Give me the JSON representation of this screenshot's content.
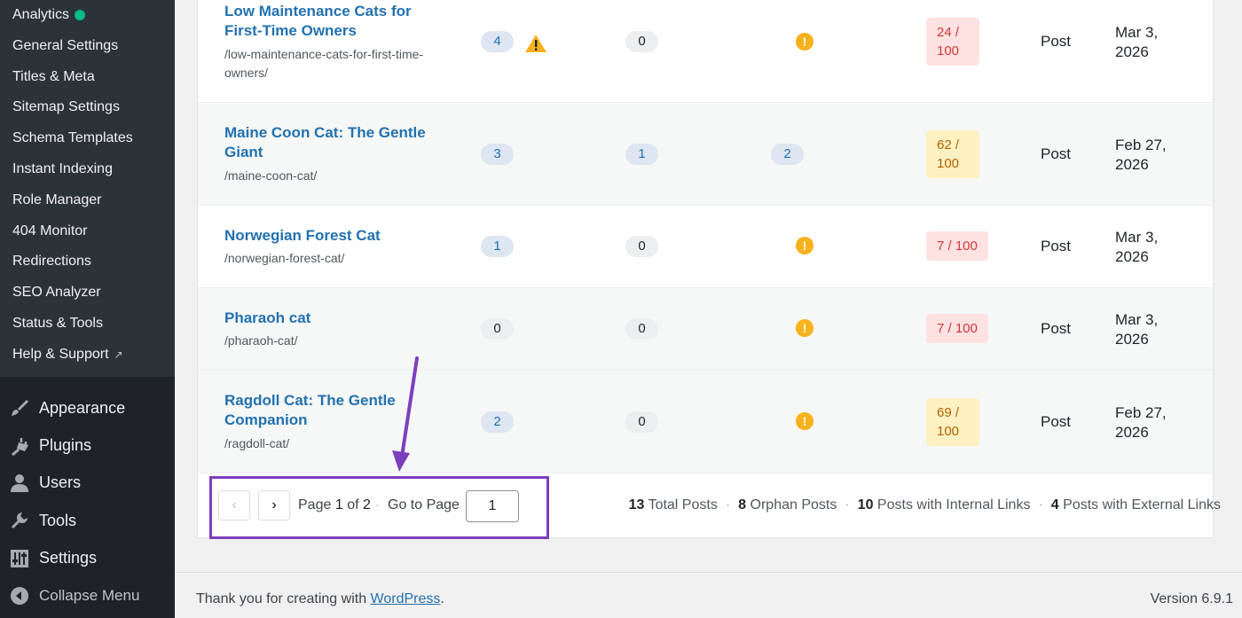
{
  "sidebar": {
    "submenu": [
      {
        "label": "Analytics",
        "status": "active"
      },
      {
        "label": "General Settings"
      },
      {
        "label": "Titles & Meta"
      },
      {
        "label": "Sitemap Settings"
      },
      {
        "label": "Schema Templates"
      },
      {
        "label": "Instant Indexing"
      },
      {
        "label": "Role Manager"
      },
      {
        "label": "404 Monitor"
      },
      {
        "label": "Redirections"
      },
      {
        "label": "SEO Analyzer"
      },
      {
        "label": "Status & Tools"
      },
      {
        "label": "Help & Support"
      }
    ],
    "menu": [
      {
        "label": "Appearance",
        "icon": "paintbrush-icon"
      },
      {
        "label": "Plugins",
        "icon": "plug-icon"
      },
      {
        "label": "Users",
        "icon": "user-icon"
      },
      {
        "label": "Tools",
        "icon": "wrench-icon"
      },
      {
        "label": "Settings",
        "icon": "sliders-icon"
      },
      {
        "label": "Collapse Menu",
        "icon": "collapse-icon"
      }
    ]
  },
  "table": {
    "rows": [
      {
        "title": "Low Maintenance Cats for First-Time Owners",
        "slug": "/low-maintenance-cats-for-first-time-owners/",
        "internal": "4",
        "internal_warning": true,
        "external": "0",
        "incoming": null,
        "score": "24 / 100",
        "score_level": "red",
        "type": "Post",
        "date": "Mar 3, 2026"
      },
      {
        "title": "Maine Coon Cat: The Gentle Giant",
        "slug": "/maine-coon-cat/",
        "internal": "3",
        "external": "1",
        "incoming": "2",
        "score": "62 / 100",
        "score_level": "yellow",
        "type": "Post",
        "date": "Feb 27, 2026"
      },
      {
        "title": "Norwegian Forest Cat",
        "slug": "/norwegian-forest-cat/",
        "internal": "1",
        "external": "0",
        "incoming": null,
        "score": "7 / 100",
        "score_level": "red",
        "type": "Post",
        "date": "Mar 3, 2026"
      },
      {
        "title": "Pharaoh cat",
        "slug": "/pharaoh-cat/",
        "internal": "0",
        "external": "0",
        "incoming": null,
        "score": "7 / 100",
        "score_level": "red",
        "type": "Post",
        "date": "Mar 3, 2026"
      },
      {
        "title": "Ragdoll Cat: The Gentle Companion",
        "slug": "/ragdoll-cat/",
        "internal": "2",
        "external": "0",
        "incoming": null,
        "score": "69 / 100",
        "score_level": "yellow",
        "type": "Post",
        "date": "Feb 27, 2026"
      }
    ]
  },
  "pagination": {
    "prev": "‹",
    "next": "›",
    "page_prefix": "Page",
    "current": "1",
    "of": "of",
    "total": "2",
    "goto_label": "Go to Page",
    "goto_value": "1"
  },
  "stats": {
    "total_posts": "13",
    "total_posts_label": "Total Posts",
    "orphan_posts": "8",
    "orphan_posts_label": "Orphan Posts",
    "internal_links": "10",
    "internal_links_label": "Posts with Internal Links",
    "external_links": "4",
    "external_links_label": "Posts with External Links"
  },
  "footer": {
    "thanks_prefix": "Thank you for creating with",
    "wordpress_link": "WordPress",
    "thanks_suffix": ".",
    "version": "Version 6.9.1"
  },
  "colors": {
    "annotation": "#7b3fbd",
    "link": "#2271b1",
    "warning": "#f6b11d",
    "score_red_bg": "#fee2e2",
    "score_yellow_bg": "#fdf1c2"
  }
}
